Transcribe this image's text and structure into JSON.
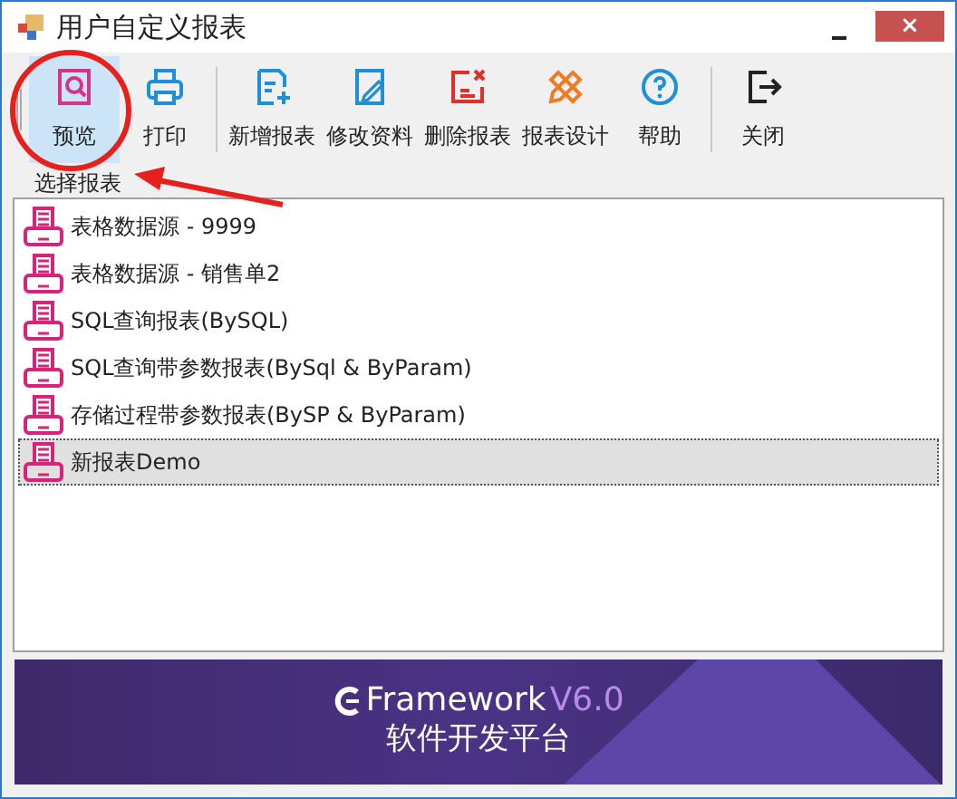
{
  "window": {
    "title": "用户自定义报表",
    "controls": [
      "×"
    ]
  },
  "toolbar": {
    "groups": [
      [
        {
          "label": "预览",
          "selected": true
        },
        {
          "label": "打印",
          "selected": false
        }
      ],
      [
        {
          "label": "新增报表",
          "selected": false
        },
        {
          "label": "修改资料",
          "selected": false
        },
        {
          "label": "删除报表",
          "selected": false
        },
        {
          "label": "报表设计",
          "selected": false
        },
        {
          "label": "帮助",
          "selected": false
        }
      ],
      [
        {
          "label": "关闭",
          "selected": false
        }
      ]
    ]
  },
  "report_group": {
    "title": "选择报表",
    "items": [
      {
        "label": "表格数据源 - 9999",
        "selected": false
      },
      {
        "label": "表格数据源 - 销售单2",
        "selected": false
      },
      {
        "label": "SQL查询报表(BySQL)",
        "selected": false
      },
      {
        "label": "SQL查询带参数报表(BySql & ByParam)",
        "selected": false
      },
      {
        "label": "存储过程带参数报表(BySP & ByParam)",
        "selected": false
      },
      {
        "label": "新报表Demo",
        "selected": true
      }
    ]
  },
  "banner": {
    "product": "Framework",
    "version": "V6.0",
    "tagline": "软件开发平台"
  }
}
